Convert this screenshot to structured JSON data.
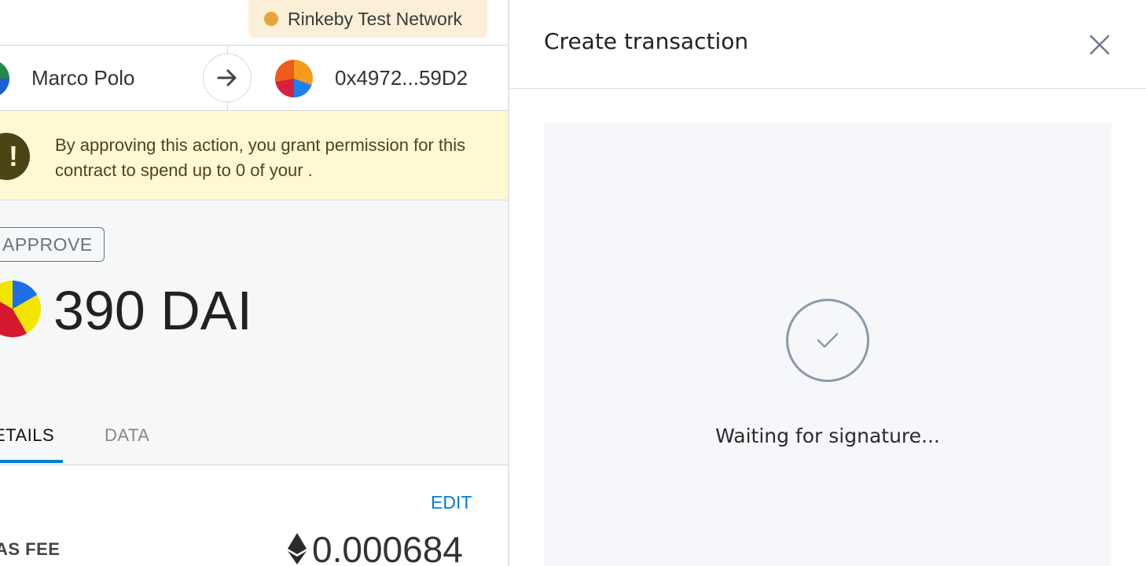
{
  "wallet": {
    "network": {
      "label": "Rinkeby Test Network",
      "dot_color": "#e6a43a"
    },
    "from": {
      "name": "Marco Polo",
      "avatar": "account-identicon"
    },
    "to": {
      "address": "0x4972...59D2",
      "avatar": "contract-identicon"
    },
    "warning": {
      "icon": "exclamation-icon",
      "text": "By approving this action, you grant permission for this contract to spend up to 0 of your ."
    },
    "action_tag": "APPROVE",
    "amount": "390 DAI",
    "tabs": [
      {
        "label": "ETAILS",
        "active": true
      },
      {
        "label": "DATA",
        "active": false
      }
    ],
    "details": {
      "edit_label": "EDIT",
      "gas_fee_label": "AS FEE",
      "gas_fee_value": "0.000684"
    },
    "accent_color": "#037dd6"
  },
  "tx_panel": {
    "title": "Create transaction",
    "close_icon": "close-icon",
    "status_icon": "checkmark-circle-icon",
    "status_text": "Waiting for signature..."
  }
}
